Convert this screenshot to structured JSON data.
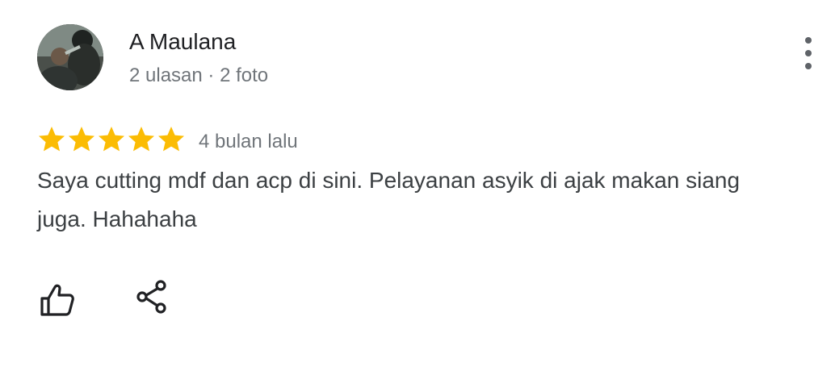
{
  "reviewer": {
    "name": "A Maulana",
    "meta": "2 ulasan · 2 foto"
  },
  "review": {
    "rating": 5,
    "max_rating": 5,
    "time": "4 bulan lalu",
    "text": "Saya cutting mdf dan acp di sini. Pelayanan asyik di ajak makan siang juga. Hahahaha"
  },
  "icons": {
    "menu": "more-vert-icon",
    "like": "thumb-up-icon",
    "share": "share-icon",
    "star": "star-icon"
  },
  "colors": {
    "star": "#fbbc04",
    "name": "#202124",
    "meta": "#70757a",
    "text": "#3c4043",
    "icon": "#202124"
  }
}
